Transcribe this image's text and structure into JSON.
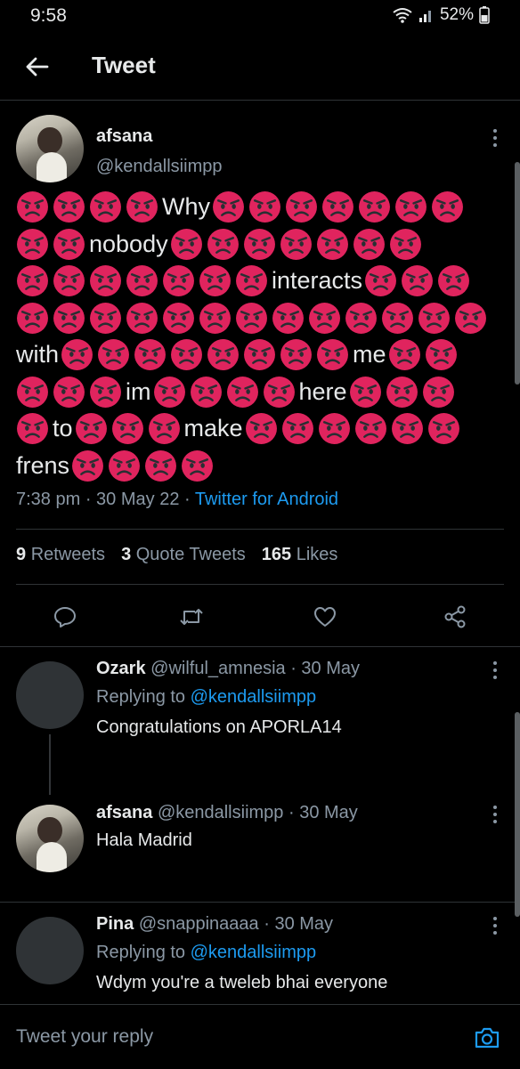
{
  "status": {
    "time": "9:58",
    "battery": "52%"
  },
  "header": {
    "title": "Tweet"
  },
  "tweet": {
    "author_name": "afsana",
    "author_handle": "@kendallsiimpp",
    "lines": [
      [
        {
          "e": 4
        },
        {
          "t": "Why"
        },
        {
          "e": 7
        }
      ],
      [
        {
          "e": 2
        },
        {
          "t": "nobody"
        },
        {
          "e": 7
        }
      ],
      [
        {
          "e": 7
        },
        {
          "t": "interacts"
        },
        {
          "e": 3
        }
      ],
      [
        {
          "e": 13
        }
      ],
      [
        {
          "t": "with"
        },
        {
          "e": 8
        },
        {
          "t": "me"
        },
        {
          "e": 2
        }
      ],
      [
        {
          "e": 3
        },
        {
          "t": "im"
        },
        {
          "e": 4
        },
        {
          "t": "here"
        },
        {
          "e": 3
        }
      ],
      [
        {
          "e": 1
        },
        {
          "t": "to"
        },
        {
          "e": 3
        },
        {
          "t": "make"
        },
        {
          "e": 6
        }
      ],
      [
        {
          "t": "frens"
        },
        {
          "e": 4
        }
      ]
    ],
    "time": "7:38 pm",
    "date": "30 May 22",
    "source": "Twitter for Android",
    "retweets_count": "9",
    "retweets_label": "Retweets",
    "quotes_count": "3",
    "quotes_label": "Quote Tweets",
    "likes_count": "165",
    "likes_label": "Likes"
  },
  "replies": [
    {
      "name": "Ozark",
      "handle": "@wilful_amnesia",
      "date": "30 May",
      "replying_prefix": "Replying to",
      "replying_to": "@kendallsiimpp",
      "text": "Congratulations on APORLA14"
    },
    {
      "name": "afsana",
      "handle": "@kendallsiimpp",
      "date": "30 May",
      "text": "Hala Madrid"
    },
    {
      "name": "Pina",
      "handle": "@snappinaaaa",
      "date": "30 May",
      "replying_prefix": "Replying to",
      "replying_to": "@kendallsiimpp",
      "text": "Wdym you're a tweleb bhai everyone"
    }
  ],
  "compose": {
    "placeholder": "Tweet your reply"
  },
  "colors": {
    "background": "#000000",
    "accent": "#1d9bf0",
    "muted": "#8b98a5",
    "emoji_face": "#e0245e"
  },
  "icons": [
    "back-arrow-icon",
    "reply-icon",
    "retweet-icon",
    "like-icon",
    "share-icon",
    "camera-icon",
    "angry-face-emoji"
  ]
}
